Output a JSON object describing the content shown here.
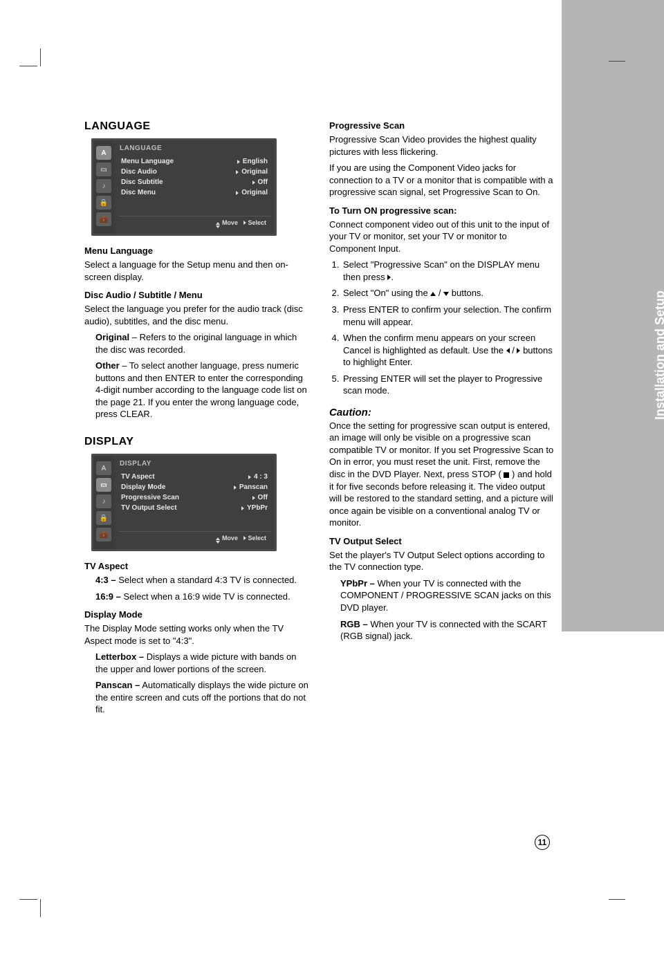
{
  "page_number": "11",
  "sidebar": {
    "tab_label": "Installation and Setup"
  },
  "left": {
    "language": {
      "heading": "LANGUAGE",
      "menu": {
        "title": "LANGUAGE",
        "rows": [
          {
            "label": "Menu Language",
            "value": "English"
          },
          {
            "label": "Disc Audio",
            "value": "Original"
          },
          {
            "label": "Disc Subtitle",
            "value": "Off"
          },
          {
            "label": "Disc Menu",
            "value": "Original"
          }
        ],
        "footer": {
          "move": "Move",
          "select": "Select"
        }
      },
      "menu_language": {
        "heading": "Menu Language",
        "body": "Select a language for the Setup menu and then on-screen display."
      },
      "disc_audio": {
        "heading": "Disc Audio / Subtitle / Menu",
        "body": "Select the language you prefer for the audio track (disc audio), subtitles, and the disc menu.",
        "original_label": "Original",
        "original_body": "– Refers to the original language in which the disc was recorded.",
        "other_label": "Other",
        "other_body": "– To select another language, press numeric buttons and then ENTER to enter the corresponding 4-digit number according to the language code list on the page 21. If you enter the wrong language code, press CLEAR."
      }
    },
    "display": {
      "heading": "DISPLAY",
      "menu": {
        "title": "DISPLAY",
        "rows": [
          {
            "label": "TV Aspect",
            "value": "4 : 3"
          },
          {
            "label": "Display Mode",
            "value": "Panscan"
          },
          {
            "label": "Progressive Scan",
            "value": "Off"
          },
          {
            "label": "TV Output Select",
            "value": "YPbPr"
          }
        ],
        "footer": {
          "move": "Move",
          "select": "Select"
        }
      },
      "tv_aspect": {
        "heading": "TV Aspect",
        "v43_label": "4:3 –",
        "v43_body": "Select when a standard 4:3 TV is connected.",
        "v169_label": "16:9 –",
        "v169_body": "Select when a 16:9 wide TV is connected."
      },
      "display_mode": {
        "heading": "Display Mode",
        "body": "The Display Mode setting works only when the TV Aspect mode is set to \"4:3\".",
        "letterbox_label": "Letterbox –",
        "letterbox_body": "Displays a wide picture with bands on the upper and lower portions of the screen.",
        "panscan_label": "Panscan –",
        "panscan_body": "Automatically displays the wide picture on the entire screen and cuts off the portions that do not fit."
      }
    }
  },
  "right": {
    "progressive_scan": {
      "heading": "Progressive Scan",
      "body1": "Progressive Scan Video provides the highest quality pictures with less flickering.",
      "body2": "If you are using the Component Video jacks for connection to a TV or a monitor that is compatible with a progressive scan signal, set Progressive Scan to On.",
      "turn_on_heading": "To Turn ON progressive scan:",
      "turn_on_body": "Connect component video out of this unit to the input of your TV or monitor, set your TV or monitor to Component Input.",
      "steps": [
        {
          "a": "Select \"Progressive Scan\" on the DISPLAY menu then press",
          "b": "."
        },
        {
          "a": "Select \"On\" using the",
          "b": "buttons."
        },
        {
          "a": "Press ENTER to confirm your selection. The confirm menu will appear."
        },
        {
          "a": "When the confirm menu appears on your screen Cancel is highlighted as default. Use the",
          "b": "buttons to highlight Enter."
        },
        {
          "a": "Pressing ENTER will set the player to Progressive scan mode."
        }
      ]
    },
    "caution": {
      "heading": "Caution:",
      "body_a": "Once the setting for progressive scan output is entered, an image will only be visible on a progressive scan compatible TV or monitor. If you set Progressive Scan to On in error, you must reset the unit. First, remove the disc in the DVD Player. Next, press STOP (",
      "body_b": ") and hold it for five seconds before releasing it. The video output will be restored to the standard setting, and a picture will once again be visible on a conventional analog TV or monitor."
    },
    "tv_output": {
      "heading": "TV Output Select",
      "body": "Set the player's TV Output Select options according to the TV connection type.",
      "ypbpr_label": "YPbPr –",
      "ypbpr_body": "When your TV is connected with the COMPONENT / PROGRESSIVE SCAN jacks on this DVD player.",
      "rgb_label": "RGB –",
      "rgb_body": "When your TV is connected with the SCART (RGB signal) jack."
    }
  }
}
